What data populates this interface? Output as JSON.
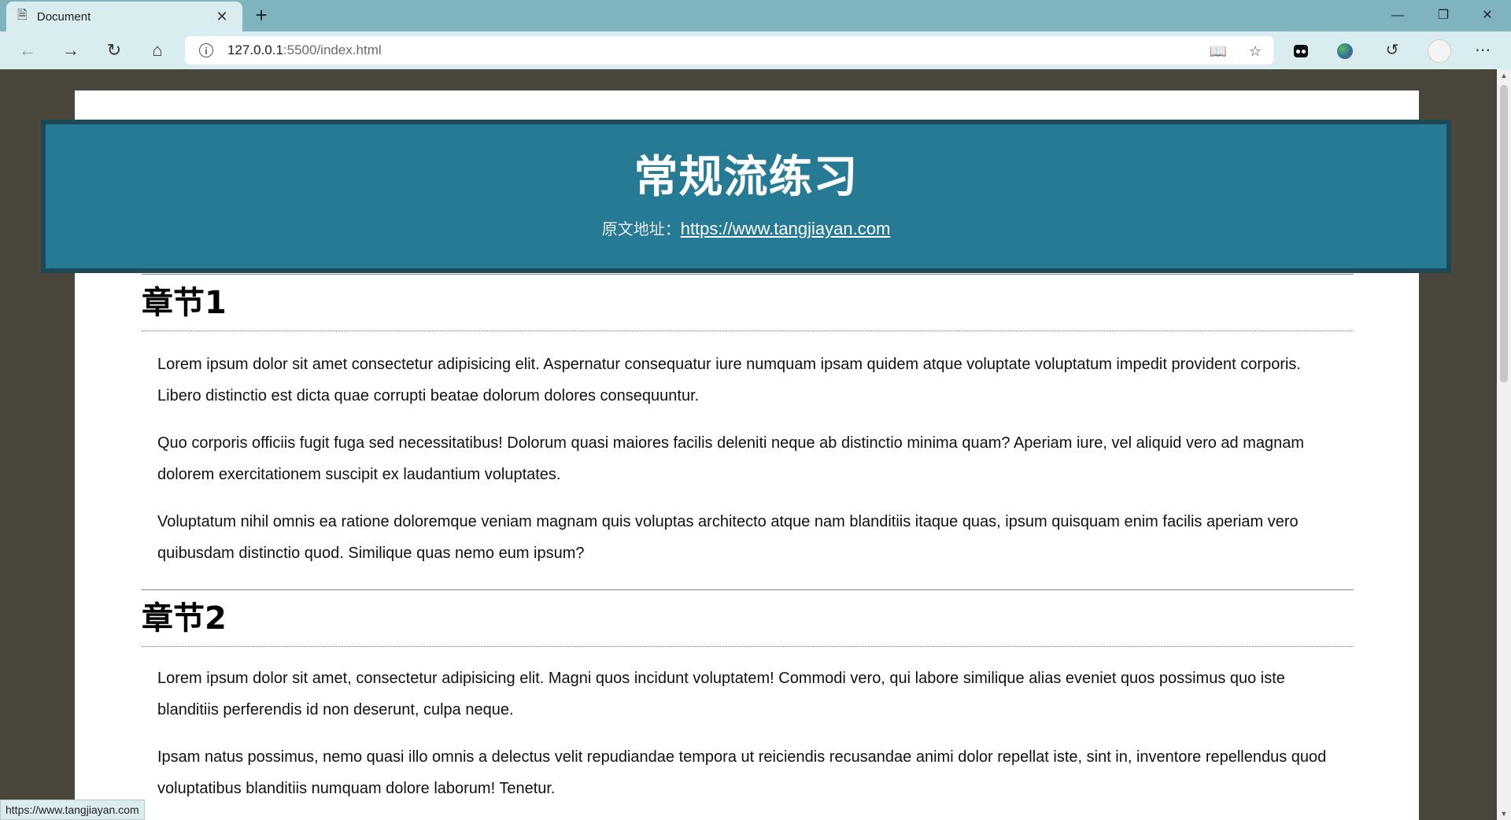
{
  "browser": {
    "tab_title": "Document",
    "url_host": "127.0.0.1",
    "url_path": ":5500/index.html",
    "status_url": "https://www.tangjiayan.com"
  },
  "page": {
    "banner": {
      "title": "常规流练习",
      "source_label": "原文地址：",
      "source_link": "https://www.tangjiayan.com"
    },
    "sections": [
      {
        "title": "章节1",
        "paragraphs": [
          "Lorem ipsum dolor sit amet consectetur adipisicing elit. Aspernatur consequatur iure numquam ipsam quidem atque voluptate voluptatum impedit provident corporis. Libero distinctio est dicta quae corrupti beatae dolorum dolores consequuntur.",
          "Quo corporis officiis fugit fuga sed necessitatibus! Dolorum quasi maiores facilis deleniti neque ab distinctio minima quam? Aperiam iure, vel aliquid vero ad magnam dolorem exercitationem suscipit ex laudantium voluptates.",
          "Voluptatum nihil omnis ea ratione doloremque veniam magnam quis voluptas architecto atque nam blanditiis itaque quas, ipsum quisquam enim facilis aperiam vero quibusdam distinctio quod. Similique quas nemo eum ipsum?"
        ]
      },
      {
        "title": "章节2",
        "paragraphs": [
          "Lorem ipsum dolor sit amet, consectetur adipisicing elit. Magni quos incidunt voluptatem! Commodi vero, qui labore similique alias eveniet quos possimus quo iste blanditiis perferendis id non deserunt, culpa neque.",
          "Ipsam natus possimus, nemo quasi illo omnis a delectus velit repudiandae tempora ut reiciendis recusandae animi dolor repellat iste, sint in, inventore repellendus quod voluptatibus blanditiis numquam dolore laborum! Tenetur."
        ]
      }
    ]
  }
}
